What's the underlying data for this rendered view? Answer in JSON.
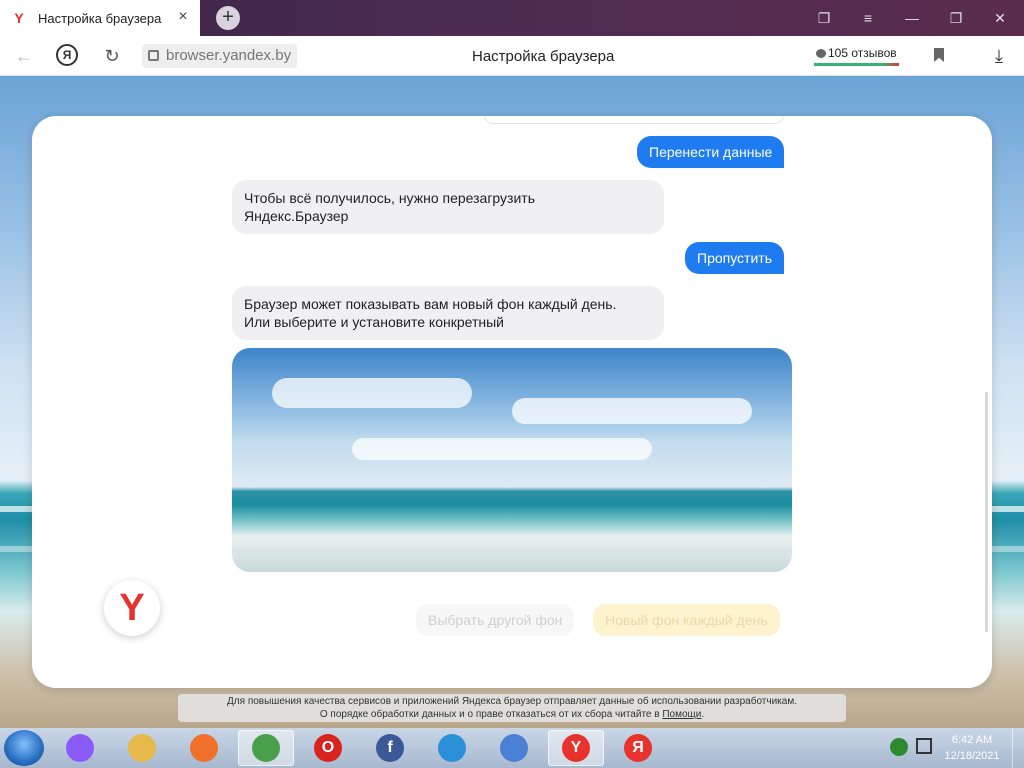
{
  "window": {
    "tab_title": "Настройка браузера",
    "tab_favicon": "Y",
    "tab_close": "×",
    "new_tab": "+",
    "controls": {
      "collections": "❐",
      "menu": "≡",
      "minimize": "—",
      "restore": "❐",
      "close": "✕"
    }
  },
  "addressbar": {
    "back": "←",
    "yandex_button": "Я",
    "reload": "↻",
    "url": "browser.yandex.by",
    "page_title": "Настройка браузера",
    "reviews": "105 отзывов",
    "download": "⤓"
  },
  "chat": {
    "messages": [
      {
        "from": "user",
        "text": "Перенести данные"
      },
      {
        "from": "bot",
        "line1": "Чтобы всё получилось, нужно перезагрузить",
        "line2": "Яндекс.Браузер"
      },
      {
        "from": "user",
        "text": "Пропустить"
      },
      {
        "from": "bot",
        "line1": "Браузер может показывать вам новый фон каждый день.",
        "line2": "Или выберите и установите конкретный"
      }
    ],
    "avatar_letter": "Y",
    "option_secondary": "Выбрать другой фон",
    "option_primary": "Новый фон каждый день"
  },
  "notice": {
    "line1": "Для повышения качества сервисов и приложений Яндекса браузер отправляет данные об использовании разработчикам.",
    "line2": "О порядке обработки данных и о праве отказаться от их сбора читайте в",
    "link": "Помощи",
    "end": "."
  },
  "taskbar": {
    "icons": [
      {
        "name": "alice-icon",
        "color": "#8a5cf6",
        "label": ""
      },
      {
        "name": "file-explorer-icon",
        "color": "#e7b84a",
        "label": ""
      },
      {
        "name": "firefox-icon",
        "color": "#f0722a",
        "label": ""
      },
      {
        "name": "chrome-icon",
        "color": "#4a9f4a",
        "label": ""
      },
      {
        "name": "opera-icon",
        "color": "#d9231f",
        "label": "O"
      },
      {
        "name": "facebook-icon",
        "color": "#3b5998",
        "label": "f"
      },
      {
        "name": "edge-icon",
        "color": "#2a8fd6",
        "label": ""
      },
      {
        "name": "chromium-icon",
        "color": "#4a7fd6",
        "label": ""
      },
      {
        "name": "yandex-browser-icon",
        "color": "#e8322d",
        "label": "Y"
      },
      {
        "name": "yandex-icon",
        "color": "#e8322d",
        "label": "Я"
      }
    ],
    "time": "6:42 AM",
    "date": "12/18/2021"
  }
}
